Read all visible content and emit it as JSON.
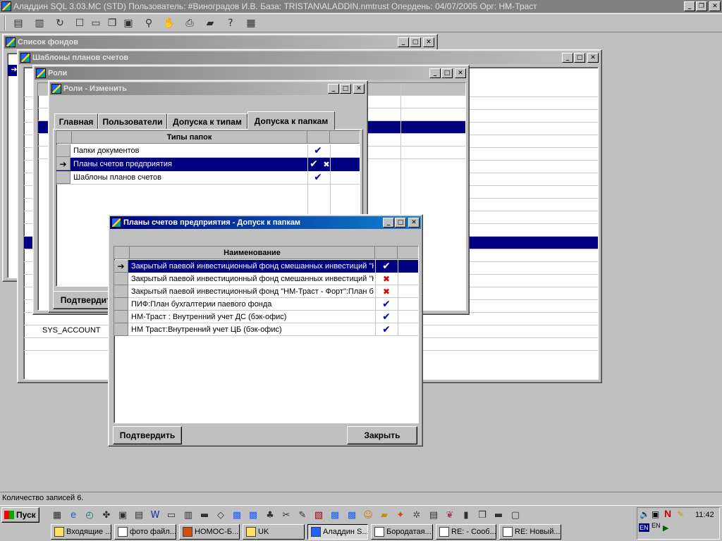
{
  "app": {
    "title": "Аладдин SQL 3.03.MC (STD)  Пользователь: #Виноградов И.В. База: TRISTAN\\ALADDIN.nmtrust Опердень: 04/07/2005 Орг: НМ-Траст"
  },
  "toolbar": {
    "icons": [
      "notepad-icon",
      "database-icon",
      "refresh-icon",
      "window-icon",
      "window-list-icon",
      "cascade-icon",
      "tile-icon",
      "binoculars-icon",
      "hand-icon",
      "print-icon",
      "folder-icon",
      "help-icon",
      "module-icon"
    ]
  },
  "windows": {
    "funds": {
      "title": "Список фондов"
    },
    "templates": {
      "title": "Шаблоны планов счетов",
      "bottom_row_text": "SYS_ACCOUNT"
    },
    "roles": {
      "title": "Роли"
    },
    "roles_edit": {
      "title": "Роли - Изменить",
      "tabs": [
        "Главная",
        "Пользователи",
        "Допуска к типам",
        "Допуска к папкам"
      ],
      "column_header": "Типы папок",
      "rows": [
        {
          "name": "Папки документов",
          "check": "✔",
          "cross": ""
        },
        {
          "name": "Планы счетов предприятия",
          "check": "✔",
          "cross": "✖"
        },
        {
          "name": "Шаблоны планов счетов",
          "check": "✔",
          "cross": ""
        }
      ],
      "confirm_label": "Подтвердить"
    },
    "access": {
      "title": "Планы счетов предприятия - Допуск к папкам",
      "column_header": "Наименование",
      "rows": [
        {
          "name": "Закрытый паевой инвестиционный фонд смешанных инвестиций \"НМ-Траст - Первый\"",
          "mark": "✔",
          "kind": "check"
        },
        {
          "name": "Закрытый паевой инвестиционный фонд смешанных инвестиций \"НМ-Траст - Второй\"",
          "mark": "✖",
          "kind": "cross"
        },
        {
          "name": "Закрытый паевой инвестиционный фонд \"НМ-Траст - Форт\":План бухгалтерии",
          "mark": "✖",
          "kind": "cross"
        },
        {
          "name": "ПИФ:План бухгалтерии паевого фонда",
          "mark": "✔",
          "kind": "check"
        },
        {
          "name": "НМ-Траст : Внутренний учет ДС (бэк-офис)",
          "mark": "✔",
          "kind": "check"
        },
        {
          "name": "НМ Траст:Внутренний учет ЦБ (бэк-офис)",
          "mark": "✔",
          "kind": "check"
        }
      ],
      "confirm_label": "Подтвердить",
      "close_label": "Закрыть"
    }
  },
  "status": {
    "text": "Количество записей 6."
  },
  "taskbar": {
    "start_label": "Пуск",
    "quicklaunch_icons": [
      "calendar-icon",
      "ie-icon",
      "clock-icon",
      "puzzle-icon",
      "app-icon",
      "keyboard-icon",
      "word-icon",
      "computer-icon",
      "grid-icon",
      "disk-icon",
      "folder-open-icon",
      "aladdin-icon",
      "aladdin-icon",
      "tree-icon",
      "tools-icon",
      "pen-icon",
      "chart-icon",
      "aladdin-icon",
      "aladdin-icon",
      "smile-icon",
      "folder-icon",
      "fox-icon",
      "gear-icon",
      "form-icon",
      "cat-icon",
      "bars-icon",
      "copy-icon",
      "disk-icon",
      "box-icon"
    ],
    "buttons": [
      "Входящие ...",
      "фото файл...",
      "НОМОС-Б...",
      "UK",
      "Аладдин S...",
      "Бородатая...",
      "RE:  - Сооб...",
      "RE: Новый..."
    ],
    "tray": {
      "lang_top": "EN",
      "lang_bottom": "EN",
      "clock": "11:42"
    }
  }
}
